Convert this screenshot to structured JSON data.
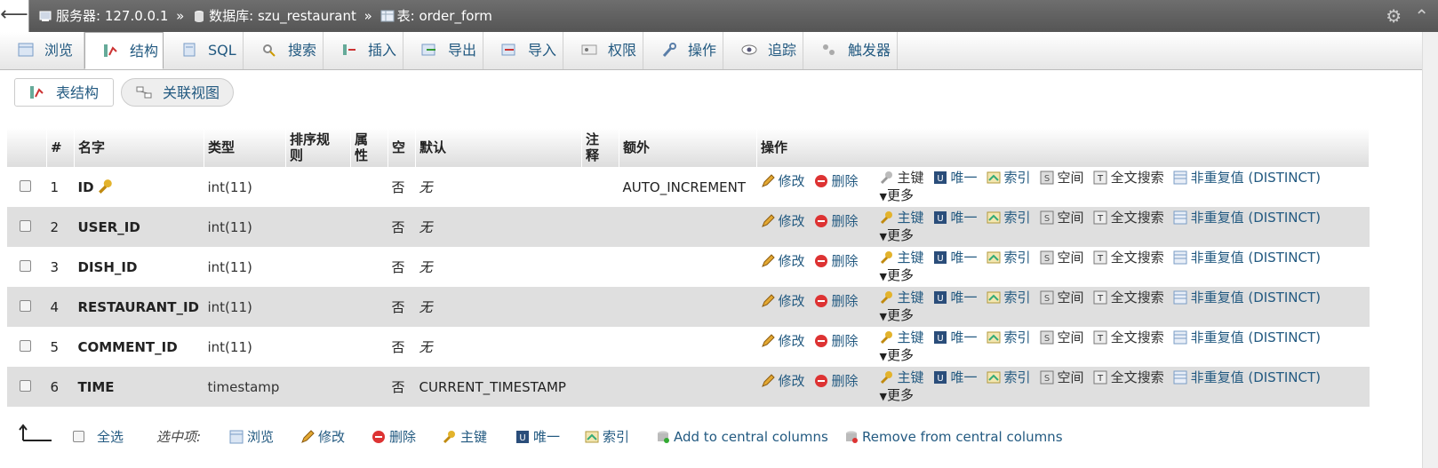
{
  "breadcrumb": {
    "server": "服务器: 127.0.0.1",
    "database": "数据库: szu_restaurant",
    "table": "表: order_form",
    "sep": "»"
  },
  "tabs": [
    "浏览",
    "结构",
    "SQL",
    "搜索",
    "插入",
    "导出",
    "导入",
    "权限",
    "操作",
    "追踪",
    "触发器"
  ],
  "subtabs": [
    "表结构",
    "关联视图"
  ],
  "columns": [
    "#",
    "名字",
    "类型",
    "排序规则",
    "属性",
    "空",
    "默认",
    "注释",
    "额外",
    "操作"
  ],
  "rows": [
    {
      "num": "1",
      "name": "ID",
      "key": true,
      "type": "int(11)",
      "null": "否",
      "default": "无",
      "default_none": true,
      "extra": "AUTO_INCREMENT"
    },
    {
      "num": "2",
      "name": "USER_ID",
      "key": false,
      "type": "int(11)",
      "null": "否",
      "default": "无",
      "default_none": true,
      "extra": ""
    },
    {
      "num": "3",
      "name": "DISH_ID",
      "key": false,
      "type": "int(11)",
      "null": "否",
      "default": "无",
      "default_none": true,
      "extra": ""
    },
    {
      "num": "4",
      "name": "RESTAURANT_ID",
      "key": false,
      "type": "int(11)",
      "null": "否",
      "default": "无",
      "default_none": true,
      "extra": ""
    },
    {
      "num": "5",
      "name": "COMMENT_ID",
      "key": false,
      "type": "int(11)",
      "null": "否",
      "default": "无",
      "default_none": true,
      "extra": ""
    },
    {
      "num": "6",
      "name": "TIME",
      "key": false,
      "type": "timestamp",
      "null": "否",
      "default": "CURRENT_TIMESTAMP",
      "default_none": false,
      "extra": ""
    }
  ],
  "row_actions": {
    "edit": "修改",
    "drop": "删除",
    "primary": "主键",
    "unique": "唯一",
    "index": "索引",
    "spatial": "空间",
    "fulltext": "全文搜索",
    "distinct": "非重复值 (DISTINCT)",
    "more": "更多"
  },
  "footer": {
    "check_all": "全选",
    "with_selected": "选中项:",
    "browse": "浏览",
    "edit": "修改",
    "drop": "删除",
    "primary": "主键",
    "unique": "唯一",
    "index": "索引",
    "add_central": "Add to central columns",
    "remove_central": "Remove from central columns"
  }
}
